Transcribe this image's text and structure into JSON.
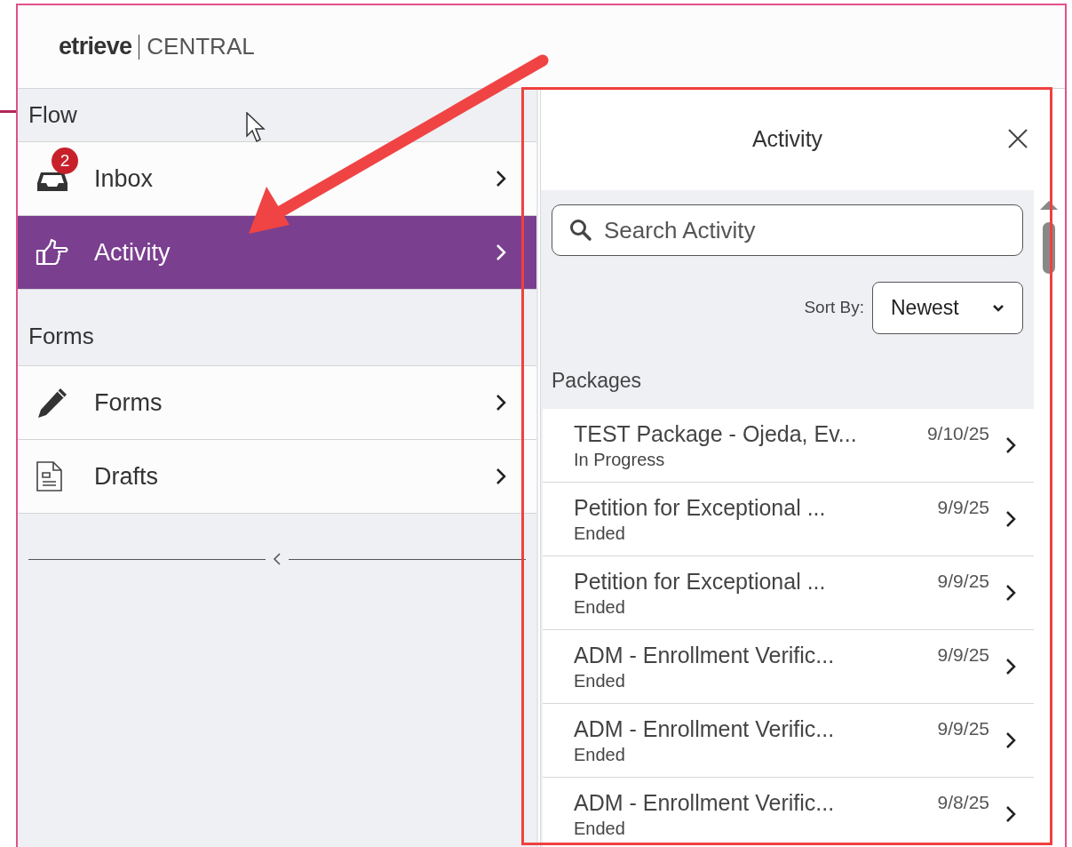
{
  "logo": {
    "brand": "etrieve",
    "product": "CENTRAL"
  },
  "sidebar": {
    "sections": [
      {
        "title": "Flow",
        "items": [
          {
            "label": "Inbox",
            "badge": "2",
            "selected": false
          },
          {
            "label": "Activity",
            "selected": true
          }
        ]
      },
      {
        "title": "Forms",
        "items": [
          {
            "label": "Forms",
            "selected": false
          },
          {
            "label": "Drafts",
            "selected": false
          }
        ]
      }
    ]
  },
  "panel": {
    "title": "Activity",
    "search": {
      "placeholder": "Search Activity"
    },
    "sort": {
      "label": "Sort By:",
      "value": "Newest"
    },
    "section_title": "Packages",
    "packages": [
      {
        "name": "TEST Package - Ojeda, Ev...",
        "status": "In Progress",
        "date": "9/10/25"
      },
      {
        "name": "Petition for Exceptional ...",
        "status": "Ended",
        "date": "9/9/25"
      },
      {
        "name": "Petition for Exceptional ...",
        "status": "Ended",
        "date": "9/9/25"
      },
      {
        "name": "ADM - Enrollment Verific...",
        "status": "Ended",
        "date": "9/9/25"
      },
      {
        "name": "ADM - Enrollment Verific...",
        "status": "Ended",
        "date": "9/9/25"
      },
      {
        "name": "ADM - Enrollment Verific...",
        "status": "Ended",
        "date": "9/8/25"
      }
    ]
  }
}
